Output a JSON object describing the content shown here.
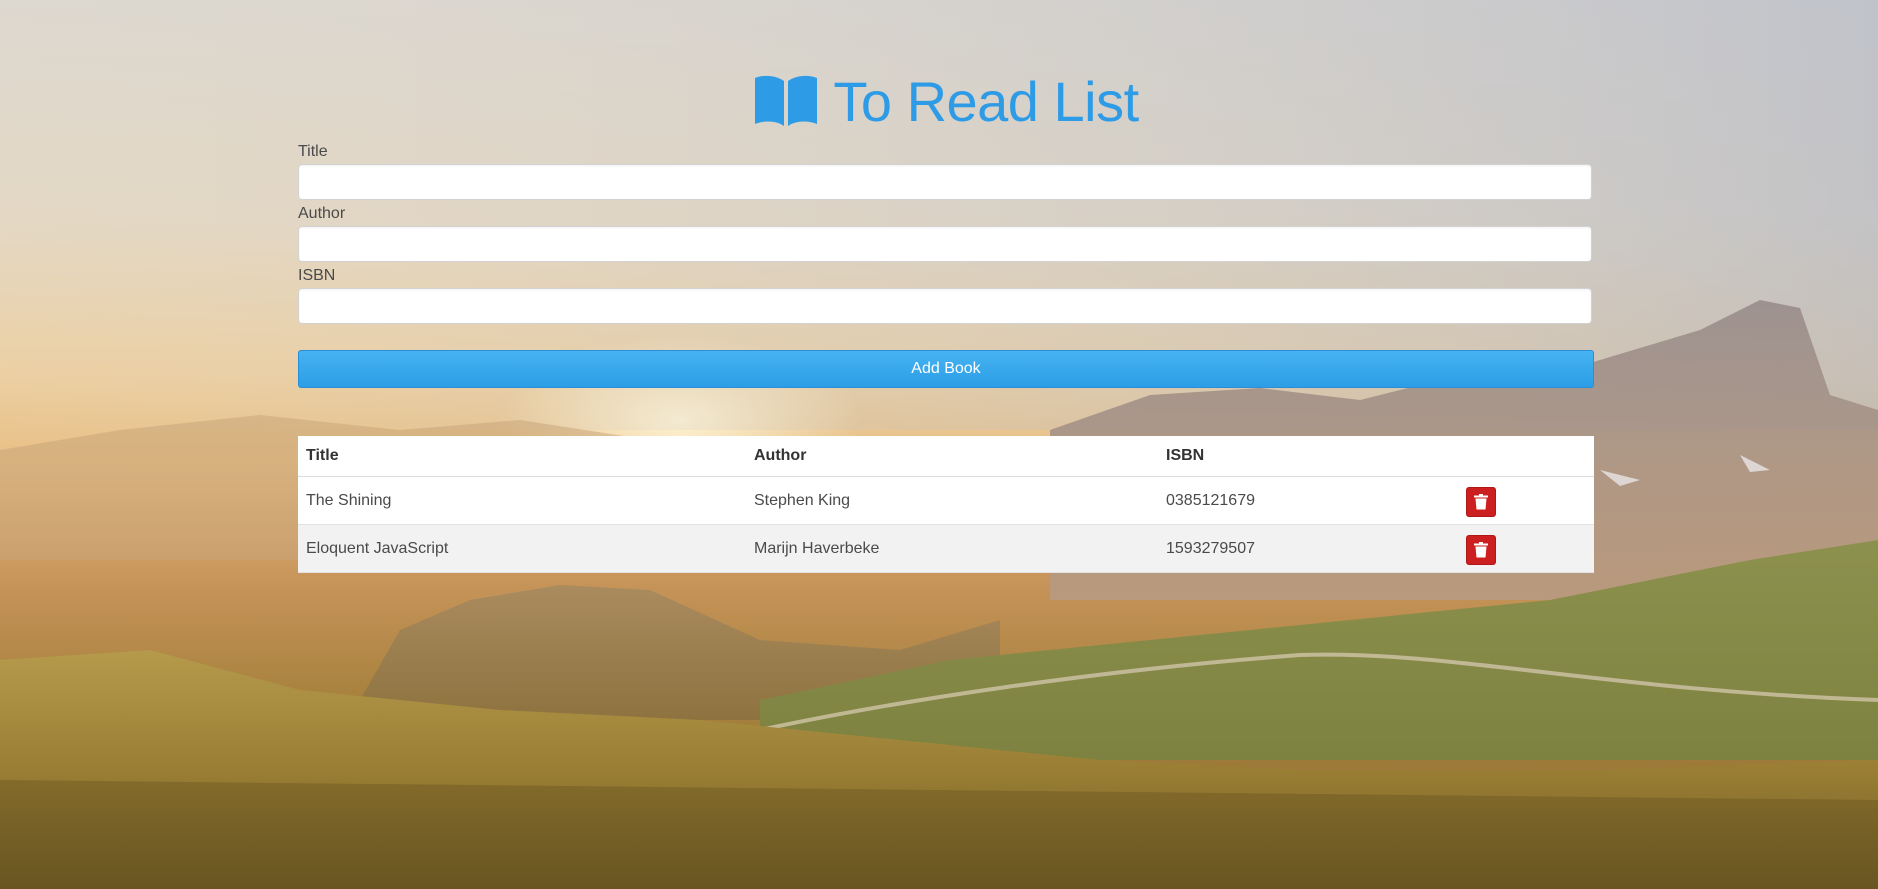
{
  "header": {
    "title": "To Read List",
    "icon": "book-open-icon",
    "color": "#2e9be6"
  },
  "form": {
    "title_label": "Title",
    "title_value": "",
    "author_label": "Author",
    "author_value": "",
    "isbn_label": "ISBN",
    "isbn_value": "",
    "submit_label": "Add Book",
    "submit_color": "#2c9ee6"
  },
  "table": {
    "columns": [
      "Title",
      "Author",
      "ISBN",
      ""
    ],
    "rows": [
      {
        "title": "The Shining",
        "author": "Stephen King",
        "isbn": "0385121679",
        "action_icon": "trash-icon"
      },
      {
        "title": "Eloquent JavaScript",
        "author": "Marijn Haverbeke",
        "isbn": "1593279507",
        "action_icon": "trash-icon"
      }
    ],
    "delete_color": "#cc1f1f"
  }
}
